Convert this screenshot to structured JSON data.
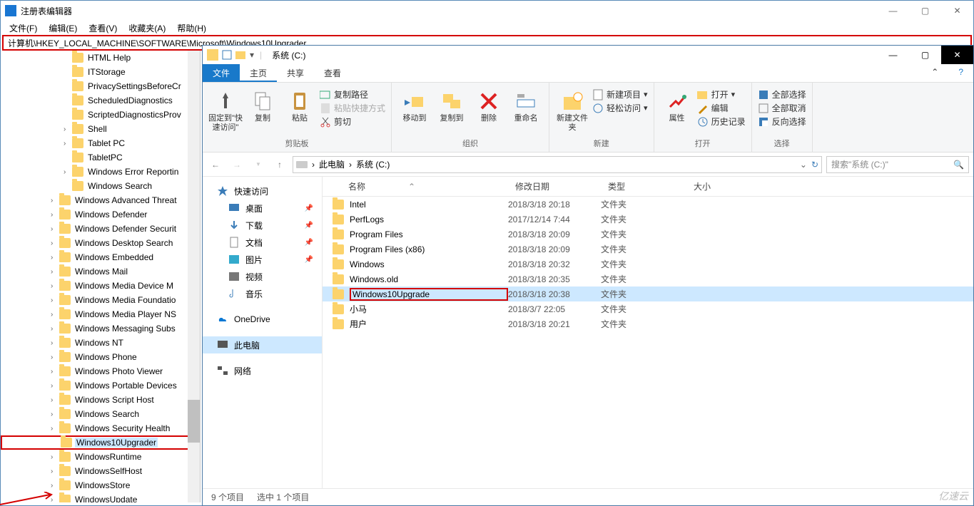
{
  "regedit": {
    "title": "注册表编辑器",
    "menu": {
      "file": "文件(F)",
      "edit": "编辑(E)",
      "view": "查看(V)",
      "favorites": "收藏夹(A)",
      "help": "帮助(H)"
    },
    "path": "计算机\\HKEY_LOCAL_MACHINE\\SOFTWARE\\Microsoft\\Windows10Upgrader",
    "tree": [
      {
        "label": "HTML Help",
        "depth": 2,
        "expand": false
      },
      {
        "label": "ITStorage",
        "depth": 2,
        "expand": false
      },
      {
        "label": "PrivacySettingsBeforeCr",
        "depth": 2,
        "expand": false
      },
      {
        "label": "ScheduledDiagnostics",
        "depth": 2,
        "expand": false
      },
      {
        "label": "ScriptedDiagnosticsProv",
        "depth": 2,
        "expand": false
      },
      {
        "label": "Shell",
        "depth": 2,
        "expand": true
      },
      {
        "label": "Tablet PC",
        "depth": 2,
        "expand": true
      },
      {
        "label": "TabletPC",
        "depth": 2,
        "expand": false
      },
      {
        "label": "Windows Error Reportin",
        "depth": 2,
        "expand": true
      },
      {
        "label": "Windows Search",
        "depth": 2,
        "expand": false
      },
      {
        "label": "Windows Advanced Threat",
        "depth": 1,
        "expand": true
      },
      {
        "label": "Windows Defender",
        "depth": 1,
        "expand": true
      },
      {
        "label": "Windows Defender Securit",
        "depth": 1,
        "expand": true
      },
      {
        "label": "Windows Desktop Search",
        "depth": 1,
        "expand": true
      },
      {
        "label": "Windows Embedded",
        "depth": 1,
        "expand": true
      },
      {
        "label": "Windows Mail",
        "depth": 1,
        "expand": true
      },
      {
        "label": "Windows Media Device M",
        "depth": 1,
        "expand": true
      },
      {
        "label": "Windows Media Foundatio",
        "depth": 1,
        "expand": true
      },
      {
        "label": "Windows Media Player NS",
        "depth": 1,
        "expand": true
      },
      {
        "label": "Windows Messaging Subs",
        "depth": 1,
        "expand": true
      },
      {
        "label": "Windows NT",
        "depth": 1,
        "expand": true
      },
      {
        "label": "Windows Phone",
        "depth": 1,
        "expand": true
      },
      {
        "label": "Windows Photo Viewer",
        "depth": 1,
        "expand": true
      },
      {
        "label": "Windows Portable Devices",
        "depth": 1,
        "expand": true
      },
      {
        "label": "Windows Script Host",
        "depth": 1,
        "expand": true
      },
      {
        "label": "Windows Search",
        "depth": 1,
        "expand": true
      },
      {
        "label": "Windows Security Health",
        "depth": 1,
        "expand": true
      },
      {
        "label": "Windows10Upgrader",
        "depth": 1,
        "expand": false,
        "sel": true
      },
      {
        "label": "WindowsRuntime",
        "depth": 1,
        "expand": true
      },
      {
        "label": "WindowsSelfHost",
        "depth": 1,
        "expand": true
      },
      {
        "label": "WindowsStore",
        "depth": 1,
        "expand": true
      },
      {
        "label": "WindowsUpdate",
        "depth": 1,
        "expand": true
      }
    ]
  },
  "explorer": {
    "titlebar": {
      "drive_label": "系统 (C:)"
    },
    "tabs": {
      "file": "文件",
      "home": "主页",
      "share": "共享",
      "view": "查看"
    },
    "ribbon": {
      "pin": "固定到\"快速访问\"",
      "copy": "复制",
      "paste": "粘贴",
      "copy_path": "复制路径",
      "paste_shortcut": "粘贴快捷方式",
      "cut": "剪切",
      "clipboard": "剪贴板",
      "move_to": "移动到",
      "copy_to": "复制到",
      "delete": "删除",
      "rename": "重命名",
      "organize": "组织",
      "new_item": "新建项目",
      "easy_access": "轻松访问",
      "new_folder": "新建文件夹",
      "new": "新建",
      "properties": "属性",
      "open_btn": "打开",
      "edit": "编辑",
      "history": "历史记录",
      "open": "打开",
      "select_all": "全部选择",
      "select_none": "全部取消",
      "invert": "反向选择",
      "select": "选择"
    },
    "nav": {
      "this_pc": "此电脑",
      "drive": "系统 (C:)",
      "search_placeholder": "搜索\"系统 (C:)\""
    },
    "sidebar": {
      "quick_access": "快速访问",
      "desktop": "桌面",
      "downloads": "下载",
      "documents": "文档",
      "pictures": "图片",
      "videos": "视频",
      "music": "音乐",
      "onedrive": "OneDrive",
      "this_pc": "此电脑",
      "network": "网络"
    },
    "columns": {
      "name": "名称",
      "date": "修改日期",
      "type": "类型",
      "size": "大小"
    },
    "files": [
      {
        "name": "Intel",
        "date": "2018/3/18 20:18",
        "type": "文件夹"
      },
      {
        "name": "PerfLogs",
        "date": "2017/12/14 7:44",
        "type": "文件夹"
      },
      {
        "name": "Program Files",
        "date": "2018/3/18 20:09",
        "type": "文件夹"
      },
      {
        "name": "Program Files (x86)",
        "date": "2018/3/18 20:09",
        "type": "文件夹"
      },
      {
        "name": "Windows",
        "date": "2018/3/18 20:32",
        "type": "文件夹"
      },
      {
        "name": "Windows.old",
        "date": "2018/3/18 20:35",
        "type": "文件夹"
      },
      {
        "name": "Windows10Upgrade",
        "date": "2018/3/18 20:38",
        "type": "文件夹",
        "sel": true,
        "boxed": true
      },
      {
        "name": "小马",
        "date": "2018/3/7 22:05",
        "type": "文件夹"
      },
      {
        "name": "用户",
        "date": "2018/3/18 20:21",
        "type": "文件夹"
      }
    ],
    "status": {
      "count": "9 个项目",
      "selected": "选中 1 个项目"
    }
  },
  "watermark": "亿速云"
}
